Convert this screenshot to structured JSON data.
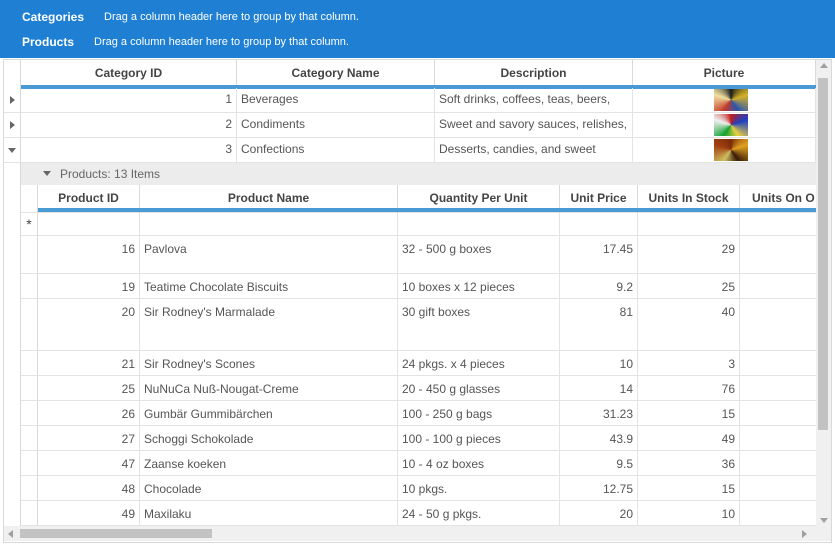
{
  "group_panel": {
    "rows": [
      {
        "label": "Categories",
        "hint": "Drag a column header here to group by that column."
      },
      {
        "label": "Products",
        "hint": "Drag a column header here to group by that column."
      }
    ]
  },
  "categories": {
    "columns": [
      "Category ID",
      "Category Name",
      "Description",
      "Picture"
    ],
    "rows": [
      {
        "id": "1",
        "name": "Beverages",
        "description": "Soft drinks, coffees, teas, beers,",
        "expanded": false
      },
      {
        "id": "2",
        "name": "Condiments",
        "description": "Sweet and savory sauces, relishes,",
        "expanded": false
      },
      {
        "id": "3",
        "name": "Confections",
        "description": "Desserts, candies, and sweet",
        "expanded": true
      }
    ]
  },
  "products": {
    "title": "Products: 13 Items",
    "columns": [
      "Product ID",
      "Product Name",
      "Quantity Per Unit",
      "Unit Price",
      "Units In Stock",
      "Units On O"
    ],
    "new_row_symbol": "*",
    "rows": [
      {
        "id": "16",
        "name": "Pavlova",
        "qty": "32 - 500 g boxes",
        "price": "17.45",
        "stock": "29"
      },
      {
        "id": "19",
        "name": "Teatime Chocolate Biscuits",
        "qty": "10 boxes x 12 pieces",
        "price": "9.2",
        "stock": "25"
      },
      {
        "id": "20",
        "name": "Sir Rodney's Marmalade",
        "qty": "30 gift boxes",
        "price": "81",
        "stock": "40"
      },
      {
        "id": "21",
        "name": "Sir Rodney's Scones",
        "qty": "24 pkgs. x 4 pieces",
        "price": "10",
        "stock": "3"
      },
      {
        "id": "25",
        "name": "NuNuCa Nuß-Nougat-Creme",
        "qty": "20 - 450 g glasses",
        "price": "14",
        "stock": "76"
      },
      {
        "id": "26",
        "name": "Gumbär Gummibärchen",
        "qty": "100 - 250 g bags",
        "price": "31.23",
        "stock": "15"
      },
      {
        "id": "27",
        "name": "Schoggi Schokolade",
        "qty": "100 - 100 g pieces",
        "price": "43.9",
        "stock": "49"
      },
      {
        "id": "47",
        "name": "Zaanse koeken",
        "qty": "10 - 4 oz boxes",
        "price": "9.5",
        "stock": "36"
      },
      {
        "id": "48",
        "name": "Chocolade",
        "qty": "10 pkgs.",
        "price": "12.75",
        "stock": "15"
      },
      {
        "id": "49",
        "name": "Maxilaku",
        "qty": "24 - 50 g pkgs.",
        "price": "20",
        "stock": "10"
      }
    ]
  },
  "colors": {
    "accent": "#1e7fd3",
    "header_line": "#4a9ad6",
    "scroll_thumb": "#c2c2c2"
  }
}
